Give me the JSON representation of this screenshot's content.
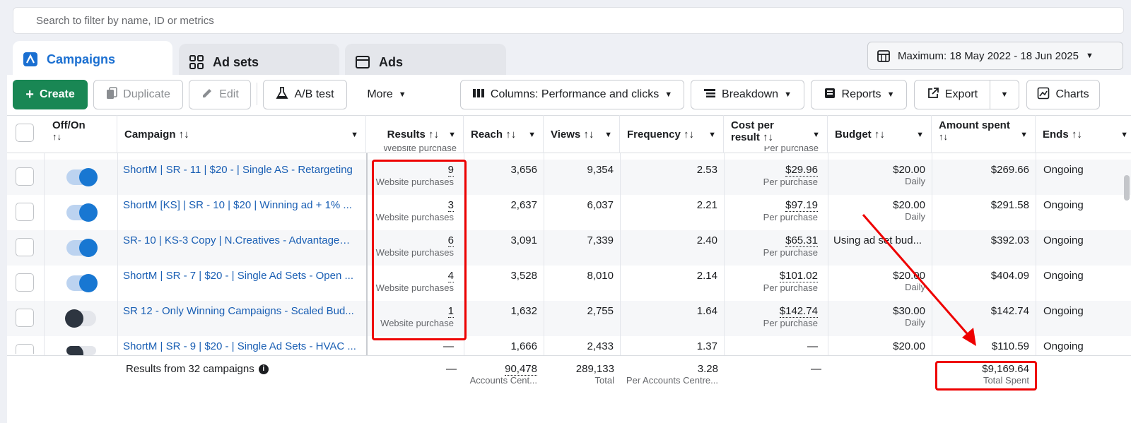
{
  "search": {
    "placeholder": "Search to filter by name, ID or metrics"
  },
  "tabs": [
    {
      "label": "Campaigns"
    },
    {
      "label": "Ad sets"
    },
    {
      "label": "Ads"
    }
  ],
  "date_range": {
    "label": "Maximum: 18 May 2022 - 18 Jun 2025"
  },
  "toolbar": {
    "create": "Create",
    "duplicate": "Duplicate",
    "edit": "Edit",
    "ab_test": "A/B test",
    "more": "More",
    "columns": "Columns: Performance and clicks",
    "breakdown": "Breakdown",
    "reports": "Reports",
    "export": "Export",
    "charts": "Charts"
  },
  "table": {
    "headers": {
      "offon": "Off/On",
      "sort": "↑↓",
      "campaign": "Campaign ↑↓",
      "results": "Results ↑↓",
      "reach": "Reach ↑↓",
      "views": "Views ↑↓",
      "frequency": "Frequency ↑↓",
      "cpr1": "Cost per",
      "cpr2": "result ↑↓",
      "budget": "Budget ↑↓",
      "amount1": "Amount spent",
      "ends": "Ends ↑↓"
    },
    "partial_row": {
      "results_sub": "Website purchase",
      "cpr_sub": "Per purchase"
    },
    "rows": [
      {
        "on": true,
        "campaign": "ShortM | SR - 11 | $20 - | Single AS - Retargeting",
        "results": "9",
        "results_sub": "Website purchases",
        "reach": "3,656",
        "views": "9,354",
        "frequency": "2.53",
        "cpr": "$29.96",
        "cpr_sub": "Per purchase",
        "budget": "$20.00",
        "budget_sub": "Daily",
        "amount": "$269.66",
        "ends": "Ongoing"
      },
      {
        "on": true,
        "campaign": "ShortM [KS] | SR - 10 | $20 | Winning ad + 1% ...",
        "results": "3",
        "results_sub": "Website purchases",
        "reach": "2,637",
        "views": "6,037",
        "frequency": "2.21",
        "cpr": "$97.19",
        "cpr_sub": "Per purchase",
        "budget": "$20.00",
        "budget_sub": "Daily",
        "amount": "$291.58",
        "ends": "Ongoing"
      },
      {
        "on": true,
        "campaign": "SR- 10 | KS-3 Copy | N.Creatives - Advantage+ ...",
        "results": "6",
        "results_sub": "Website purchases",
        "reach": "3,091",
        "views": "7,339",
        "frequency": "2.40",
        "cpr": "$65.31",
        "cpr_sub": "Per purchase",
        "budget": "Using ad set bud...",
        "budget_sub": "",
        "amount": "$392.03",
        "ends": "Ongoing"
      },
      {
        "on": true,
        "campaign": "ShortM | SR - 7 | $20 - | Single Ad Sets - Open ...",
        "results": "4",
        "results_sub": "Website purchases",
        "reach": "3,528",
        "views": "8,010",
        "frequency": "2.14",
        "cpr": "$101.02",
        "cpr_sub": "Per purchase",
        "budget": "$20.00",
        "budget_sub": "Daily",
        "amount": "$404.09",
        "ends": "Ongoing"
      },
      {
        "on": false,
        "campaign": "SR 12 - Only Winning Campaigns - Scaled Bud...",
        "results": "1",
        "results_sub": "Website purchase",
        "reach": "1,632",
        "views": "2,755",
        "frequency": "1.64",
        "cpr": "$142.74",
        "cpr_sub": "Per purchase",
        "budget": "$30.00",
        "budget_sub": "Daily",
        "amount": "$142.74",
        "ends": "Ongoing"
      },
      {
        "on": false,
        "campaign": "ShortM | SR - 9 | $20 - | Single Ad Sets - HVAC ...",
        "results": "—",
        "results_sub": "",
        "reach": "1,666",
        "views": "2,433",
        "frequency": "1.37",
        "cpr": "—",
        "cpr_sub": "",
        "budget": "$20.00",
        "budget_sub": "",
        "amount": "$110.59",
        "ends": "Ongoing"
      }
    ],
    "footer": {
      "label": "Results from 32 campaigns",
      "results": "—",
      "reach": "90,478",
      "reach_sub": "Accounts Cent...",
      "views": "289,133",
      "views_sub": "Total",
      "frequency": "3.28",
      "frequency_sub": "Per Accounts Centre...",
      "cpr": "—",
      "amount": "$9,169.64",
      "amount_sub": "Total Spent"
    }
  },
  "colors": {
    "accent": "#1877d2",
    "create": "#198754",
    "highlight": "#e00000"
  }
}
